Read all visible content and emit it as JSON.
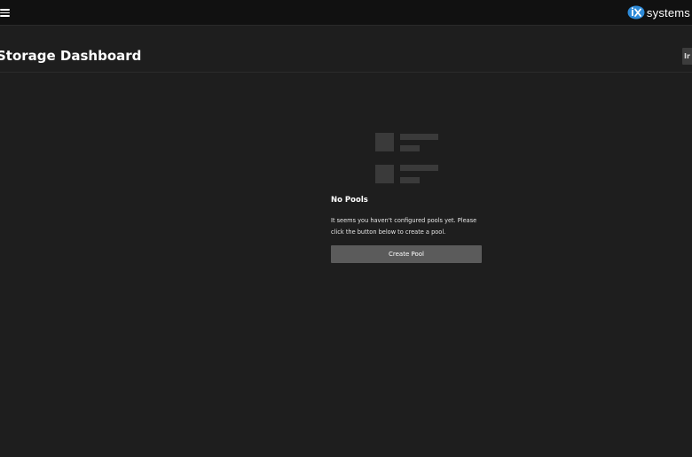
{
  "topbar": {
    "brand_text": "systems",
    "brand_badge": "iX",
    "menu_icon": "hamburger-menu-icon",
    "brand_color": "#2d8ad8"
  },
  "page": {
    "title": "Storage Dashboard",
    "right_button_label": "Ir"
  },
  "empty_state": {
    "icon": "list-placeholder-icon",
    "title": "No Pools",
    "description": "It seems you haven't configured pools yet. Please click the button below to create a pool.",
    "button_label": "Create Pool"
  },
  "colors": {
    "background": "#1e1e1e",
    "topbar": "#111111",
    "button": "#5b5b5b",
    "placeholder": "#3a3a3a"
  }
}
